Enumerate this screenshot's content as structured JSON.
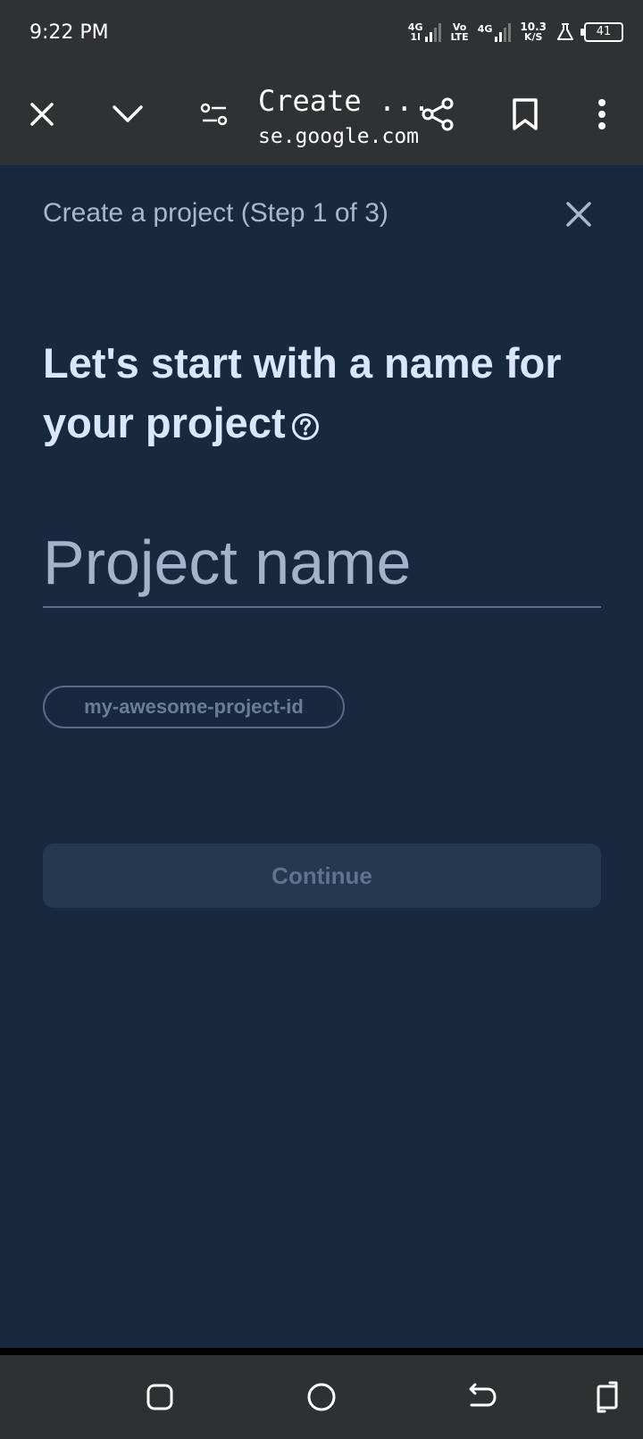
{
  "status_bar": {
    "time": "9:22 PM",
    "sim1_top": "4G",
    "sim1_bottom": "1l",
    "volte_top": "Vo",
    "volte_bottom": "LTE",
    "sim2_top": "4G",
    "speed_value": "10.3",
    "speed_unit": "K/S",
    "battery": "41"
  },
  "toolbar": {
    "title": "Create ...",
    "url": "se.google.com",
    "icons": [
      "close-icon",
      "chevron-down-icon",
      "page-info-icon",
      "share-icon",
      "bookmark-icon",
      "more-vert-icon"
    ]
  },
  "dialog": {
    "title": "Create a project (Step 1 of 3)",
    "heading": "Let's start with a name for your project",
    "project_name_placeholder": "Project name",
    "project_id": "my-awesome-project-id",
    "continue_label": "Continue"
  },
  "nav_bar": {
    "icons": [
      "recents-icon",
      "home-icon",
      "back-icon",
      "rotate-icon"
    ]
  },
  "colors": {
    "background": "#18293f",
    "chrome": "#303134",
    "heading": "#d9e6fb",
    "muted": "#a7b7cc"
  }
}
